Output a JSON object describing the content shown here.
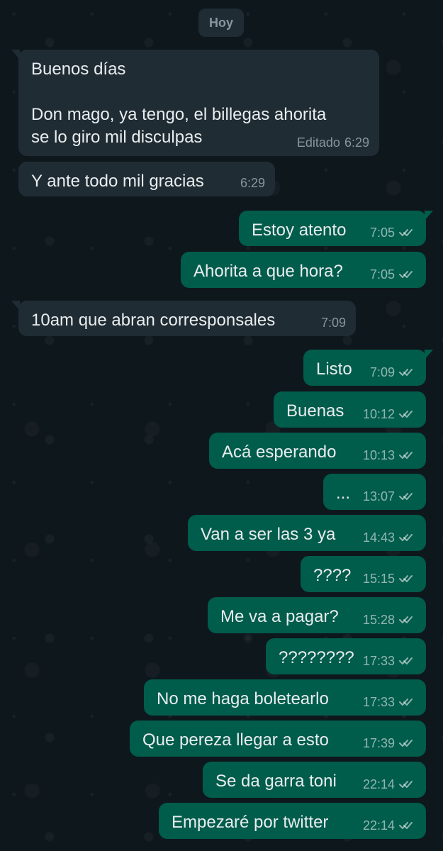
{
  "date_chip": "Hoy",
  "messages": [
    {
      "direction": "incoming",
      "text": "Buenos días\n\nDon mago, ya tengo,  el billegas ahorita\nse lo giro mil disculpas",
      "edited_label": "Editado",
      "time": "6:29"
    },
    {
      "direction": "incoming",
      "text": "Y ante todo mil gracias",
      "time": "6:29"
    },
    {
      "direction": "outgoing",
      "text": "Estoy atento",
      "time": "7:05",
      "status_icon": "double-check-icon"
    },
    {
      "direction": "outgoing",
      "text": "Ahorita a que hora?",
      "time": "7:05",
      "status_icon": "double-check-icon"
    },
    {
      "direction": "incoming",
      "text": "10am que abran corresponsales",
      "time": "7:09"
    },
    {
      "direction": "outgoing",
      "text": "Listo",
      "time": "7:09",
      "status_icon": "double-check-icon"
    },
    {
      "direction": "outgoing",
      "text": "Buenas",
      "time": "10:12",
      "status_icon": "double-check-icon"
    },
    {
      "direction": "outgoing",
      "text": "Acá esperando",
      "time": "10:13",
      "status_icon": "double-check-icon"
    },
    {
      "direction": "outgoing",
      "text": "...",
      "time": "13:07",
      "status_icon": "double-check-icon"
    },
    {
      "direction": "outgoing",
      "text": "Van a ser las 3 ya",
      "time": "14:43",
      "status_icon": "double-check-icon"
    },
    {
      "direction": "outgoing",
      "text": "????",
      "time": "15:15",
      "status_icon": "double-check-icon"
    },
    {
      "direction": "outgoing",
      "text": "Me va a pagar?",
      "time": "15:28",
      "status_icon": "double-check-icon"
    },
    {
      "direction": "outgoing",
      "text": "????????",
      "time": "17:33",
      "status_icon": "double-check-icon"
    },
    {
      "direction": "outgoing",
      "text": "No me haga boletearlo",
      "time": "17:33",
      "status_icon": "double-check-icon"
    },
    {
      "direction": "outgoing",
      "text": "Que pereza llegar a esto",
      "time": "17:39",
      "status_icon": "double-check-icon"
    },
    {
      "direction": "outgoing",
      "text": "Se da garra toni",
      "time": "22:14",
      "status_icon": "double-check-icon"
    },
    {
      "direction": "outgoing",
      "text": "Empezaré por twitter",
      "time": "22:14",
      "status_icon": "double-check-icon"
    }
  ],
  "colors": {
    "wallpaper": "#0e171c",
    "incoming_bubble": "#202c33",
    "outgoing_bubble": "#005c4b",
    "message_text": "#e9edef",
    "meta_text": "#8696a0"
  }
}
